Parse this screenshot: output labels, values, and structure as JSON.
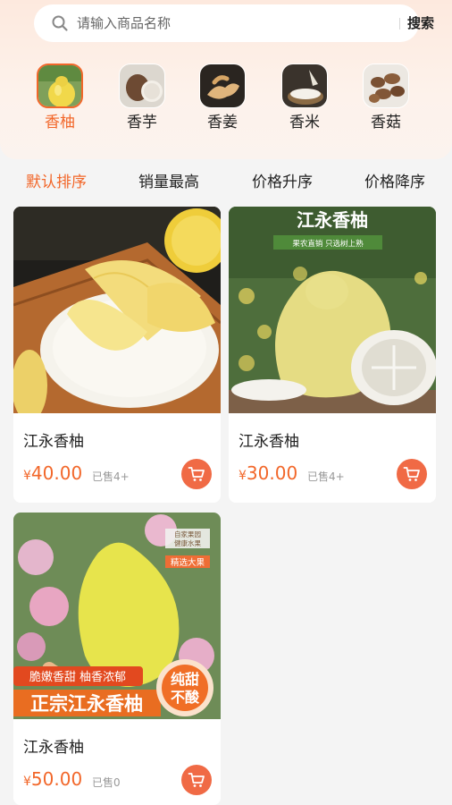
{
  "search": {
    "placeholder": "请输入商品名称",
    "button": "搜索"
  },
  "categories": [
    {
      "label": "香柚",
      "active": true
    },
    {
      "label": "香芋",
      "active": false
    },
    {
      "label": "香姜",
      "active": false
    },
    {
      "label": "香米",
      "active": false
    },
    {
      "label": "香菇",
      "active": false
    }
  ],
  "sort_tabs": [
    {
      "label": "默认排序",
      "active": true
    },
    {
      "label": "销量最高",
      "active": false
    },
    {
      "label": "价格升序",
      "active": false
    },
    {
      "label": "价格降序",
      "active": false
    }
  ],
  "products": [
    {
      "title": "江永香柚",
      "currency": "¥",
      "price": "40.00",
      "sold_prefix": "已售",
      "sold": "4+",
      "image_text": []
    },
    {
      "title": "江永香柚",
      "currency": "¥",
      "price": "30.00",
      "sold_prefix": "已售",
      "sold": "4+",
      "image_text": [
        "江永香柚",
        "果农直销 只选树上熟"
      ]
    },
    {
      "title": "江永香柚",
      "currency": "¥",
      "price": "50.00",
      "sold_prefix": "已售",
      "sold": "0",
      "image_text": [
        "自家果园 健康水果",
        "精选大果",
        "脆嫩香甜 柚香浓郁",
        "正宗江永香柚",
        "纯甜",
        "不酸"
      ]
    }
  ],
  "colors": {
    "accent": "#f2672a",
    "cart": "#f06a45",
    "header_bg": "#fde9de",
    "page_bg": "#f4f4f4"
  }
}
